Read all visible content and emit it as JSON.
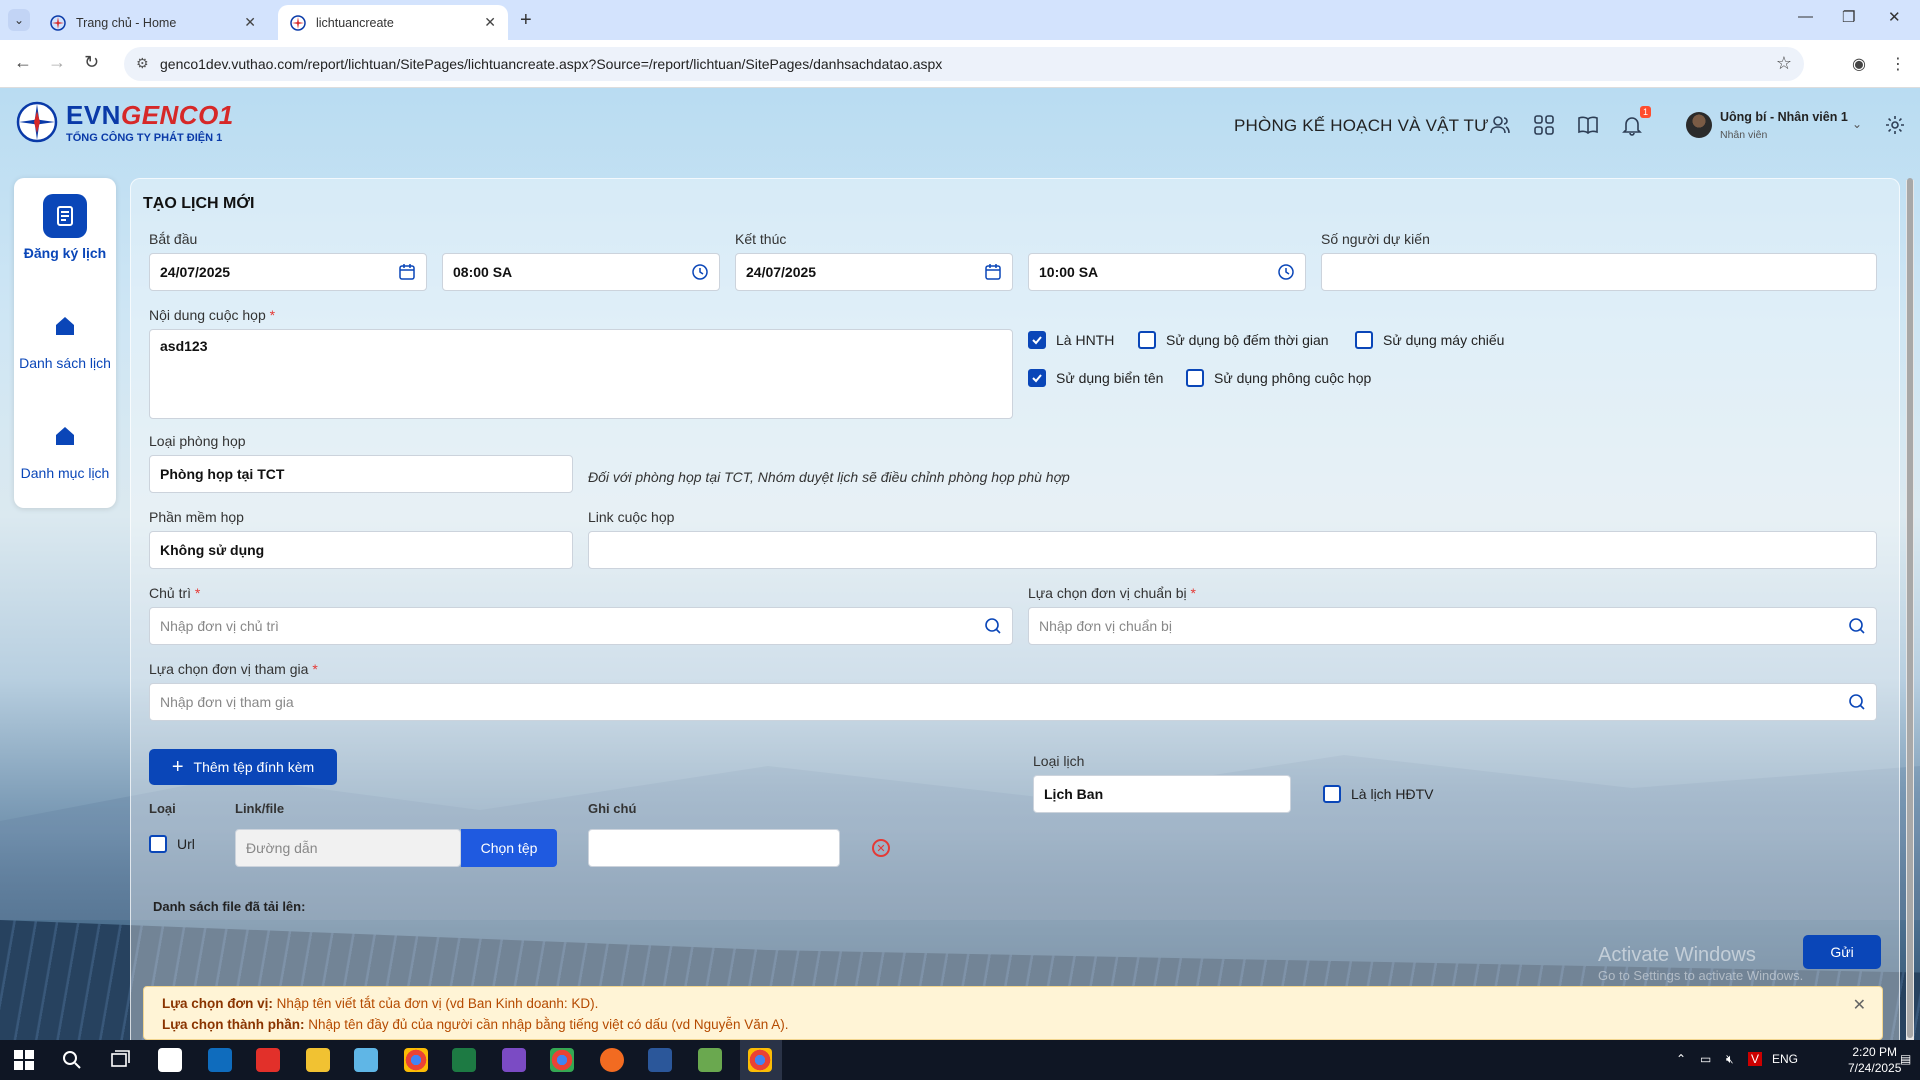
{
  "browser": {
    "tabs": [
      {
        "title": "Trang chủ - Home",
        "active": false
      },
      {
        "title": "lichtuancreate",
        "active": true
      }
    ],
    "url": "genco1dev.vuthao.com/report/lichtuan/SitePages/lichtuancreate.aspx?Source=/report/lichtuan/SitePages/danhsachdatao.aspx"
  },
  "header": {
    "brand_evn": "EVN",
    "brand_genco": "GENCO1",
    "brand_sub": "TỔNG CÔNG TY PHÁT ĐIỆN 1",
    "department": "PHÒNG KẾ HOẠCH VÀ VẬT TƯ",
    "notification_count": "1",
    "user_name": "Uông bí - Nhân viên 1",
    "user_role": "Nhân viên"
  },
  "sidebar": {
    "items": [
      {
        "label": "Đăng ký lịch",
        "icon": "calendar-form-icon",
        "active": true
      },
      {
        "label": "Danh sách lịch",
        "icon": "home-icon",
        "active": false
      },
      {
        "label": "Danh mục lịch",
        "icon": "home-icon",
        "active": false
      }
    ]
  },
  "form": {
    "title": "TẠO LỊCH MỚI",
    "start_label": "Bắt đầu",
    "start_date": "24/07/2025",
    "start_time": "08:00 SA",
    "end_label": "Kết thúc",
    "end_date": "24/07/2025",
    "end_time": "10:00 SA",
    "attendees_label": "Số người dự kiến",
    "attendees_value": "",
    "content_label": "Nội dung cuộc họp",
    "content_value": "asd123",
    "options": {
      "hnth": "Là HNTH",
      "timer": "Sử dụng bộ đếm thời gian",
      "projector": "Sử dụng máy chiếu",
      "nameplate": "Sử dụng biển tên",
      "backdrop": "Sử dụng phông cuộc họp"
    },
    "room_type_label": "Loại phòng họp",
    "room_type_value": "Phòng họp tại TCT",
    "room_note": "Đối với phòng họp tại TCT, Nhóm duyệt lịch sẽ điều chỉnh phòng họp phù hợp",
    "software_label": "Phần mềm họp",
    "software_value": "Không sử dụng",
    "link_label": "Link cuộc họp",
    "link_value": "",
    "host_label": "Chủ trì",
    "host_placeholder": "Nhập đơn vị chủ trì",
    "prep_label": "Lựa chọn đơn vị chuẩn bị",
    "prep_placeholder": "Nhập đơn vị chuẩn bị",
    "participants_label": "Lựa chọn đơn vị tham gia",
    "participants_placeholder": "Nhập đơn vị tham gia",
    "add_attachment": "Thêm tệp đính kèm",
    "schedule_type_label": "Loại lịch",
    "schedule_type_value": "Lịch Ban",
    "hdtv_label": "Là lịch HĐTV",
    "attach_cols": {
      "type": "Loại",
      "link": "Link/file",
      "note": "Ghi chú"
    },
    "url_label": "Url",
    "path_placeholder": "Đường dẫn",
    "choose_file": "Chọn tệp",
    "uploaded_list": "Danh sách file đã tải lên:",
    "submit": "Gửi"
  },
  "watermark": {
    "line1": "Activate Windows",
    "line2": "Go to Settings to activate Windows."
  },
  "hint": {
    "unit_label": "Lựa chọn đơn vị:",
    "unit_text": " Nhập tên viết tắt của đơn vị (vd Ban Kinh doanh: KD).",
    "member_label": "Lựa chọn thành phần:",
    "member_text": " Nhập tên đầy đủ của người cần nhập bằng tiếng việt có dấu (vd Nguyễn Văn A)."
  },
  "taskbar": {
    "lang": "ENG",
    "time": "2:20 PM",
    "date": "7/24/2025"
  },
  "colors": {
    "primary": "#0a46b8",
    "required": "#e53935",
    "hint_bg": "#fff4d6"
  }
}
